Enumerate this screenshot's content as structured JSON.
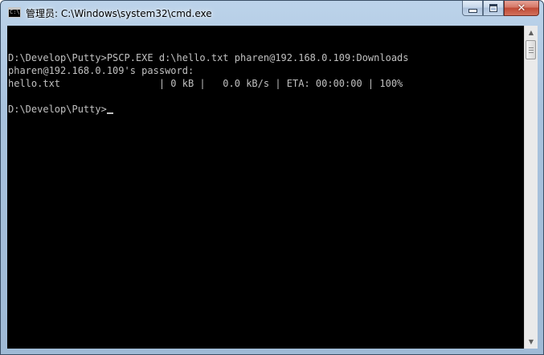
{
  "window": {
    "title": "管理员: C:\\Windows\\system32\\cmd.exe",
    "icon": "cmd-app-icon",
    "icon_glyph": "C:\\"
  },
  "caption_buttons": {
    "minimize_icon": "minimize-icon",
    "maximize_icon": "maximize-icon",
    "close_icon": "close-icon",
    "close_glyph": "✕"
  },
  "console": {
    "background": "#000000",
    "foreground": "#c0c0c0",
    "lines": [
      "",
      "D:\\Develop\\Putty>PSCP.EXE d:\\hello.txt pharen@192.168.0.109:Downloads",
      "pharen@192.168.0.109's password:",
      "hello.txt                 | 0 kB |   0.0 kB/s | ETA: 00:00:00 | 100%",
      "",
      "D:\\Develop\\Putty>"
    ]
  },
  "scrollbar": {
    "up_arrow": "▲",
    "down_arrow": "▼"
  }
}
